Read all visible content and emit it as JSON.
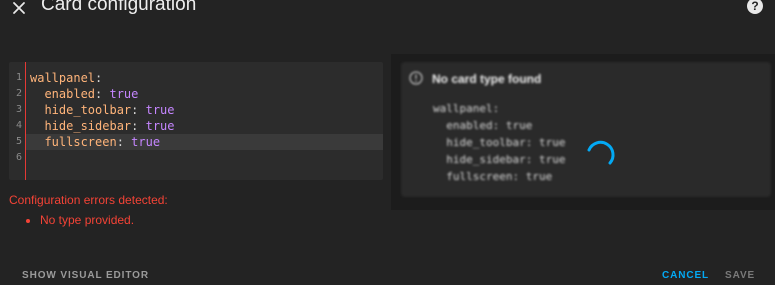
{
  "dialog": {
    "title": "Card configuration",
    "close_icon": "close-icon",
    "help_icon": "help-circle-icon"
  },
  "editor": {
    "line_numbers": [
      "1",
      "2",
      "3",
      "4",
      "5",
      "6"
    ],
    "lines": [
      {
        "key": "wallpanel",
        "sep": ":",
        "value": ""
      },
      {
        "key": "  enabled",
        "sep": ": ",
        "value": "true"
      },
      {
        "key": "  hide_toolbar",
        "sep": ": ",
        "value": "true"
      },
      {
        "key": "  hide_sidebar",
        "sep": ": ",
        "value": "true"
      },
      {
        "key": "  fullscreen",
        "sep": ": ",
        "value": "true"
      },
      {
        "key": "",
        "sep": "",
        "value": ""
      }
    ],
    "active_line": 5
  },
  "errors": {
    "title": "Configuration errors detected:",
    "items": [
      "No type provided."
    ]
  },
  "preview": {
    "title": "No card type found",
    "warning_icon": "alert-circle-icon",
    "code": [
      "wallpanel:",
      "  enabled: true",
      "  hide_toolbar: true",
      "  hide_sidebar: true",
      "  fullscreen: true"
    ],
    "spinner_icon": "loading-spinner-icon"
  },
  "footer": {
    "show_visual_editor": "SHOW VISUAL EDITOR",
    "cancel": "CANCEL",
    "save": "SAVE"
  },
  "colors": {
    "background": "#232323",
    "error": "#f44336",
    "accent": "#03a9f4",
    "yaml_key": "#ffb47a",
    "yaml_value": "#c586ff"
  }
}
